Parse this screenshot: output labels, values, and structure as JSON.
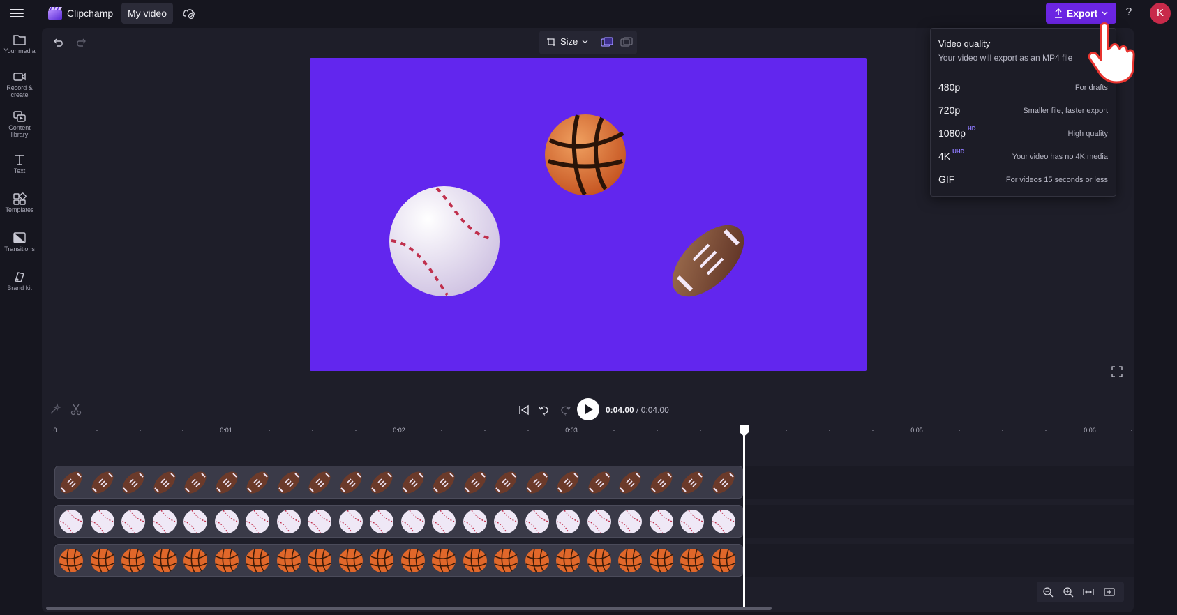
{
  "app": {
    "name": "Clipchamp",
    "project_title": "My video",
    "export_label": "Export",
    "help_label": "?",
    "avatar_initial": "K",
    "accent_color": "#6b25e3"
  },
  "sidebar": {
    "items": [
      {
        "label": "Your media",
        "icon": "folder-icon"
      },
      {
        "label": "Record & create",
        "icon": "camera-icon"
      },
      {
        "label": "Content library",
        "icon": "library-icon"
      },
      {
        "label": "Text",
        "icon": "text-icon"
      },
      {
        "label": "Templates",
        "icon": "templates-icon"
      },
      {
        "label": "Transitions",
        "icon": "transitions-icon"
      },
      {
        "label": "Brand kit",
        "icon": "brand-kit-icon"
      }
    ]
  },
  "preview": {
    "size_label": "Size",
    "canvas_color": "#6226ee"
  },
  "export_panel": {
    "title": "Video quality",
    "subtitle": "Your video will export as an MP4 file",
    "options": [
      {
        "resolution": "480p",
        "badge": "",
        "description": "For drafts"
      },
      {
        "resolution": "720p",
        "badge": "",
        "description": "Smaller file, faster export"
      },
      {
        "resolution": "1080p",
        "badge": "HD",
        "description": "High quality"
      },
      {
        "resolution": "4K",
        "badge": "UHD",
        "description": "Your video has no 4K media"
      },
      {
        "resolution": "GIF",
        "badge": "",
        "description": "For videos 15 seconds or less"
      }
    ]
  },
  "playback": {
    "current_time": "0:04.00",
    "total_time": "/ 0:04.00"
  },
  "timeline": {
    "ruler_labels": [
      "0",
      "0:01",
      "0:02",
      "0:03",
      "0:05",
      "0:06"
    ],
    "tracks": [
      {
        "name": "football-track",
        "clip": "football"
      },
      {
        "name": "baseball-track",
        "clip": "baseball"
      },
      {
        "name": "basketball-track",
        "clip": "basketball"
      }
    ]
  }
}
